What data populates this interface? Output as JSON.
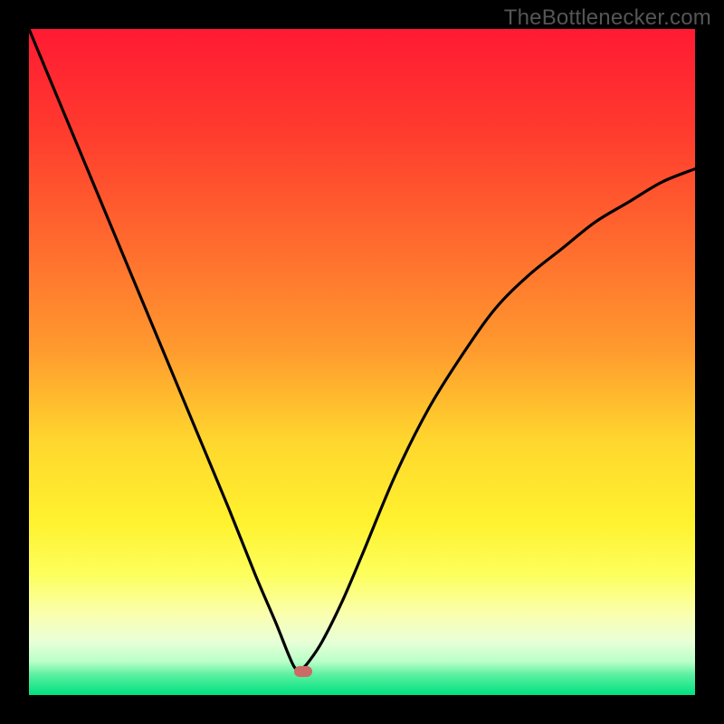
{
  "watermark": "TheBottlenecker.com",
  "marker": {
    "color": "#cc6a66",
    "x_pct": 41.2,
    "y_pct": 96.4
  },
  "gradient_stops": [
    {
      "pct": 0,
      "color": "#ff1a33"
    },
    {
      "pct": 15,
      "color": "#ff3a2e"
    },
    {
      "pct": 32,
      "color": "#ff6a2e"
    },
    {
      "pct": 48,
      "color": "#ff9a2e"
    },
    {
      "pct": 62,
      "color": "#ffd72e"
    },
    {
      "pct": 74,
      "color": "#fff22e"
    },
    {
      "pct": 82,
      "color": "#fdff5e"
    },
    {
      "pct": 88,
      "color": "#faffb0"
    },
    {
      "pct": 92,
      "color": "#e8ffd8"
    },
    {
      "pct": 95,
      "color": "#b8ffc8"
    },
    {
      "pct": 97,
      "color": "#5af0a0"
    },
    {
      "pct": 100,
      "color": "#00e080"
    }
  ],
  "chart_data": {
    "type": "line",
    "title": "",
    "xlabel": "",
    "ylabel": "",
    "xlim": [
      0,
      100
    ],
    "ylim": [
      0,
      100
    ],
    "x": [
      0,
      5,
      10,
      15,
      20,
      25,
      30,
      34,
      37,
      39,
      40,
      41,
      42,
      44,
      47,
      50,
      55,
      60,
      65,
      70,
      75,
      80,
      85,
      90,
      95,
      100
    ],
    "y": [
      100,
      88,
      76,
      64,
      52,
      40,
      28,
      18,
      11,
      6,
      4,
      4,
      5,
      8,
      14,
      21,
      33,
      43,
      51,
      58,
      63,
      67,
      71,
      74,
      77,
      79
    ],
    "annotations": [
      {
        "type": "marker",
        "x": 41,
        "y": 4,
        "shape": "pill",
        "color": "#cc6a66"
      }
    ],
    "grid": false,
    "legend": false
  }
}
